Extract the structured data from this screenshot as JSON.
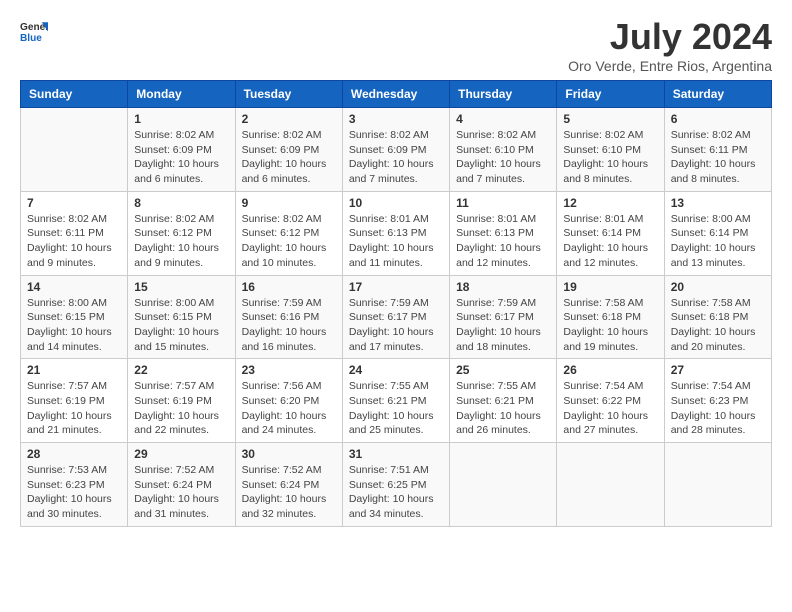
{
  "header": {
    "logo_line1": "General",
    "logo_line2": "Blue",
    "title": "July 2024",
    "subtitle": "Oro Verde, Entre Rios, Argentina"
  },
  "calendar": {
    "days_of_week": [
      "Sunday",
      "Monday",
      "Tuesday",
      "Wednesday",
      "Thursday",
      "Friday",
      "Saturday"
    ],
    "weeks": [
      [
        {
          "day": "",
          "info": ""
        },
        {
          "day": "1",
          "info": "Sunrise: 8:02 AM\nSunset: 6:09 PM\nDaylight: 10 hours\nand 6 minutes."
        },
        {
          "day": "2",
          "info": "Sunrise: 8:02 AM\nSunset: 6:09 PM\nDaylight: 10 hours\nand 6 minutes."
        },
        {
          "day": "3",
          "info": "Sunrise: 8:02 AM\nSunset: 6:09 PM\nDaylight: 10 hours\nand 7 minutes."
        },
        {
          "day": "4",
          "info": "Sunrise: 8:02 AM\nSunset: 6:10 PM\nDaylight: 10 hours\nand 7 minutes."
        },
        {
          "day": "5",
          "info": "Sunrise: 8:02 AM\nSunset: 6:10 PM\nDaylight: 10 hours\nand 8 minutes."
        },
        {
          "day": "6",
          "info": "Sunrise: 8:02 AM\nSunset: 6:11 PM\nDaylight: 10 hours\nand 8 minutes."
        }
      ],
      [
        {
          "day": "7",
          "info": ""
        },
        {
          "day": "8",
          "info": "Sunrise: 8:02 AM\nSunset: 6:12 PM\nDaylight: 10 hours\nand 9 minutes."
        },
        {
          "day": "9",
          "info": "Sunrise: 8:02 AM\nSunset: 6:12 PM\nDaylight: 10 hours\nand 10 minutes."
        },
        {
          "day": "10",
          "info": "Sunrise: 8:01 AM\nSunset: 6:13 PM\nDaylight: 10 hours\nand 11 minutes."
        },
        {
          "day": "11",
          "info": "Sunrise: 8:01 AM\nSunset: 6:13 PM\nDaylight: 10 hours\nand 12 minutes."
        },
        {
          "day": "12",
          "info": "Sunrise: 8:01 AM\nSunset: 6:14 PM\nDaylight: 10 hours\nand 12 minutes."
        },
        {
          "day": "13",
          "info": "Sunrise: 8:00 AM\nSunset: 6:14 PM\nDaylight: 10 hours\nand 13 minutes."
        }
      ],
      [
        {
          "day": "14",
          "info": ""
        },
        {
          "day": "15",
          "info": "Sunrise: 8:00 AM\nSunset: 6:15 PM\nDaylight: 10 hours\nand 15 minutes."
        },
        {
          "day": "16",
          "info": "Sunrise: 7:59 AM\nSunset: 6:16 PM\nDaylight: 10 hours\nand 16 minutes."
        },
        {
          "day": "17",
          "info": "Sunrise: 7:59 AM\nSunset: 6:17 PM\nDaylight: 10 hours\nand 17 minutes."
        },
        {
          "day": "18",
          "info": "Sunrise: 7:59 AM\nSunset: 6:17 PM\nDaylight: 10 hours\nand 18 minutes."
        },
        {
          "day": "19",
          "info": "Sunrise: 7:58 AM\nSunset: 6:18 PM\nDaylight: 10 hours\nand 19 minutes."
        },
        {
          "day": "20",
          "info": "Sunrise: 7:58 AM\nSunset: 6:18 PM\nDaylight: 10 hours\nand 20 minutes."
        }
      ],
      [
        {
          "day": "21",
          "info": ""
        },
        {
          "day": "22",
          "info": "Sunrise: 7:57 AM\nSunset: 6:19 PM\nDaylight: 10 hours\nand 22 minutes."
        },
        {
          "day": "23",
          "info": "Sunrise: 7:56 AM\nSunset: 6:20 PM\nDaylight: 10 hours\nand 24 minutes."
        },
        {
          "day": "24",
          "info": "Sunrise: 7:55 AM\nSunset: 6:21 PM\nDaylight: 10 hours\nand 25 minutes."
        },
        {
          "day": "25",
          "info": "Sunrise: 7:55 AM\nSunset: 6:21 PM\nDaylight: 10 hours\nand 26 minutes."
        },
        {
          "day": "26",
          "info": "Sunrise: 7:54 AM\nSunset: 6:22 PM\nDaylight: 10 hours\nand 27 minutes."
        },
        {
          "day": "27",
          "info": "Sunrise: 7:54 AM\nSunset: 6:23 PM\nDaylight: 10 hours\nand 28 minutes."
        }
      ],
      [
        {
          "day": "28",
          "info": ""
        },
        {
          "day": "29",
          "info": "Sunrise: 7:52 AM\nSunset: 6:24 PM\nDaylight: 10 hours\nand 31 minutes."
        },
        {
          "day": "30",
          "info": "Sunrise: 7:52 AM\nSunset: 6:24 PM\nDaylight: 10 hours\nand 32 minutes."
        },
        {
          "day": "31",
          "info": "Sunrise: 7:51 AM\nSunset: 6:25 PM\nDaylight: 10 hours\nand 34 minutes."
        },
        {
          "day": "",
          "info": ""
        },
        {
          "day": "",
          "info": ""
        },
        {
          "day": "",
          "info": ""
        }
      ]
    ],
    "week_sun_info": [
      "",
      "Sunrise: 8:02 AM\nSunset: 6:11 PM\nDaylight: 10 hours\nand 9 minutes.",
      "Sunrise: 8:00 AM\nSunset: 6:15 PM\nDaylight: 10 hours\nand 14 minutes.",
      "Sunrise: 7:57 AM\nSunset: 6:19 PM\nDaylight: 10 hours\nand 21 minutes.",
      "Sunrise: 7:53 AM\nSunset: 6:23 PM\nDaylight: 10 hours\nand 30 minutes."
    ]
  }
}
